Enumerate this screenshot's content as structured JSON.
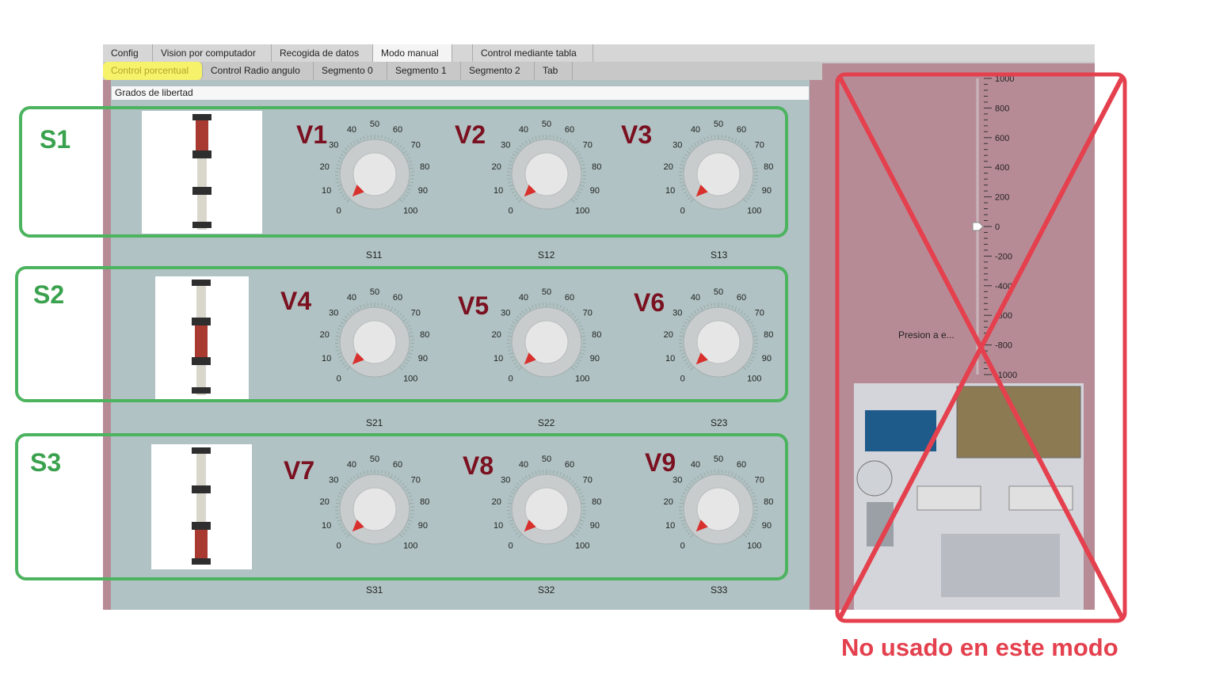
{
  "tabs_row1": [
    "Config",
    "Vision por computador",
    "Recogida de datos",
    "Modo manual",
    "Control mediante tabla"
  ],
  "tabs_row2": [
    "Control porcentual",
    "Control Radio angulo",
    "Segmento 0",
    "Segmento 1",
    "Segmento 2",
    "Tab"
  ],
  "group_title": "Grados de libertad",
  "sections": [
    {
      "label": "S1",
      "knobs": [
        {
          "v": "V1",
          "name": "S11",
          "value": 0
        },
        {
          "v": "V2",
          "name": "S12",
          "value": 0
        },
        {
          "v": "V3",
          "name": "S13",
          "value": 0
        }
      ]
    },
    {
      "label": "S2",
      "knobs": [
        {
          "v": "V4",
          "name": "S21",
          "value": 0
        },
        {
          "v": "V5",
          "name": "S22",
          "value": 0
        },
        {
          "v": "V6",
          "name": "S23",
          "value": 0
        }
      ]
    },
    {
      "label": "S3",
      "knobs": [
        {
          "v": "V7",
          "name": "S31",
          "value": 0
        },
        {
          "v": "V8",
          "name": "S32",
          "value": 0
        },
        {
          "v": "V9",
          "name": "S33",
          "value": 0
        }
      ]
    }
  ],
  "knob_ticks": [
    "0",
    "10",
    "20",
    "30",
    "40",
    "50",
    "60",
    "70",
    "80",
    "90",
    "100"
  ],
  "pressure_scale": [
    "1000",
    "800",
    "600",
    "400",
    "200",
    "0",
    "-200",
    "-400",
    "-600",
    "-800",
    "-1000"
  ],
  "pressure_value": 0,
  "pressure_label": "Presion a e...",
  "annotation": "No usado en este modo",
  "colors": {
    "green": "#4cb35f",
    "red_x": "#e4404e",
    "v_label": "#7a1020",
    "highlight": "#f6f26a"
  }
}
